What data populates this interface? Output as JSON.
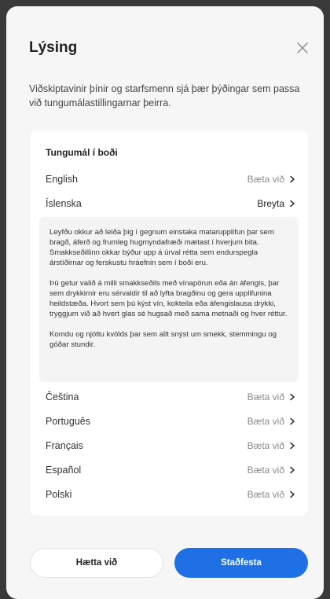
{
  "dialog": {
    "title": "Lýsing",
    "description": "Viðskiptavinir þínir og starfsmenn sjá þær þýðingar sem passa við tungumálastillingarnar þeirra."
  },
  "card": {
    "title": "Tungumál í boði",
    "languages": [
      {
        "name": "English",
        "action": "Bæta við"
      },
      {
        "name": "Íslenska",
        "action": "Breyta"
      },
      {
        "name": "Čeština",
        "action": "Bæta við"
      },
      {
        "name": "Português",
        "action": "Bæta við"
      },
      {
        "name": "Français",
        "action": "Bæta við"
      },
      {
        "name": "Español",
        "action": "Bæta við"
      },
      {
        "name": "Polski",
        "action": "Bæta við"
      }
    ],
    "description_paragraphs": [
      "Leyfðu okkur að leiða þig í gegnum einstaka matarupplifun þar sem bragð, áferð og frumleg hugmyndafræði mætast í hverjum bita. Smakkseðillinn okkar býður upp á úrval rétta sem endurspegla árstíðirnar og ferskustu hráefnin sem í boði eru.",
      "Þú getur valið á milli smakkseðils með vínapörun eða án áfengis, þar sem drykkirnir eru sérvaldir til að lyfta bragðinu og gera upplifunina heildstæða. Hvort sem þú kýst vín, kokteila eða áfengislausa drykki, tryggjum við að hvert glas sé hugsað með sama metnaði og hver réttur.",
      "Komdu og njóttu kvölds þar sem allt snýst um smekk, stemmingu og góðar stundir."
    ]
  },
  "footer": {
    "cancel_label": "Hætta við",
    "confirm_label": "Staðfesta"
  },
  "colors": {
    "primary": "#1f6fe5",
    "muted_text": "#8a8a8a"
  },
  "icons": {
    "close": "close-icon",
    "chevron": "chevron-right-icon"
  }
}
